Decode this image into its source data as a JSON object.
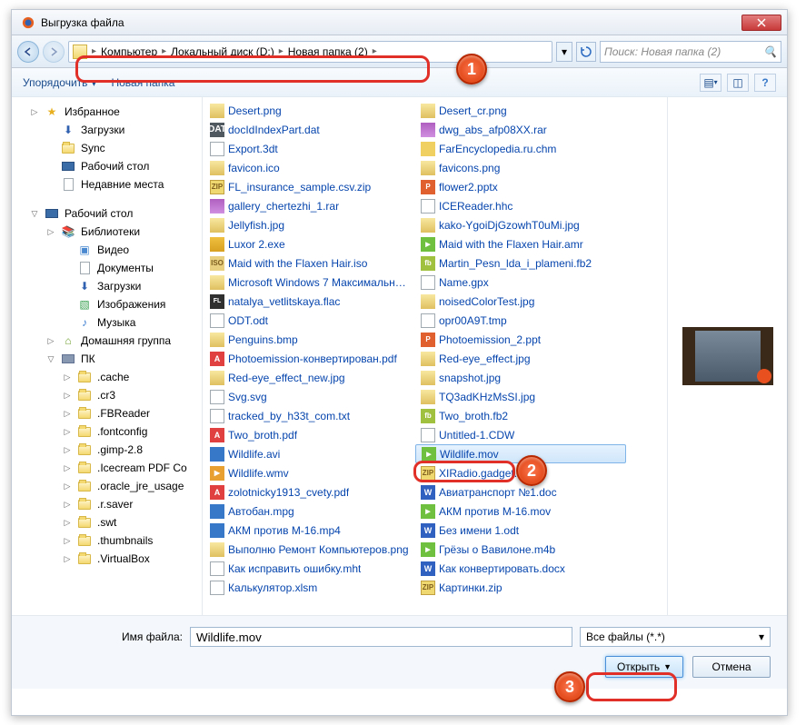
{
  "window": {
    "title": "Выгрузка файла"
  },
  "breadcrumb": [
    {
      "label": "Компьютер"
    },
    {
      "label": "Локальный диск (D:)"
    },
    {
      "label": "Новая папка (2)"
    }
  ],
  "search": {
    "placeholder": "Поиск: Новая папка (2)"
  },
  "toolbar": {
    "organize": "Упорядочить",
    "newfolder": "Новая папка"
  },
  "sidebar": [
    {
      "label": "Избранное",
      "lvl": 1,
      "icon": "star",
      "tog": "▷"
    },
    {
      "label": "Загрузки",
      "lvl": 2,
      "icon": "down"
    },
    {
      "label": "Sync",
      "lvl": 2,
      "icon": "folder"
    },
    {
      "label": "Рабочий стол",
      "lvl": 2,
      "icon": "desk"
    },
    {
      "label": "Недавние места",
      "lvl": 2,
      "icon": "doc"
    },
    {
      "label": "",
      "lvl": 0,
      "spacer": true
    },
    {
      "label": "Рабочий стол",
      "lvl": 1,
      "icon": "desk",
      "tog": "▽"
    },
    {
      "label": "Библиотеки",
      "lvl": 2,
      "icon": "lib",
      "tog": "▷"
    },
    {
      "label": "Видео",
      "lvl": 3,
      "icon": "vid"
    },
    {
      "label": "Документы",
      "lvl": 3,
      "icon": "doc"
    },
    {
      "label": "Загрузки",
      "lvl": 3,
      "icon": "down"
    },
    {
      "label": "Изображения",
      "lvl": 3,
      "icon": "pic"
    },
    {
      "label": "Музыка",
      "lvl": 3,
      "icon": "music"
    },
    {
      "label": "Домашняя группа",
      "lvl": 2,
      "icon": "home",
      "tog": "▷"
    },
    {
      "label": "ПК",
      "lvl": 2,
      "icon": "comp",
      "tog": "▽"
    },
    {
      "label": ".cache",
      "lvl": 3,
      "icon": "folder",
      "tog": "▷"
    },
    {
      "label": ".cr3",
      "lvl": 3,
      "icon": "folder",
      "tog": "▷"
    },
    {
      "label": ".FBReader",
      "lvl": 3,
      "icon": "folder",
      "tog": "▷"
    },
    {
      "label": ".fontconfig",
      "lvl": 3,
      "icon": "folder",
      "tog": "▷"
    },
    {
      "label": ".gimp-2.8",
      "lvl": 3,
      "icon": "folder",
      "tog": "▷"
    },
    {
      "label": ".Icecream PDF Co",
      "lvl": 3,
      "icon": "folder",
      "tog": "▷"
    },
    {
      "label": ".oracle_jre_usage",
      "lvl": 3,
      "icon": "folder",
      "tog": "▷"
    },
    {
      "label": ".r.saver",
      "lvl": 3,
      "icon": "folder",
      "tog": "▷"
    },
    {
      "label": ".swt",
      "lvl": 3,
      "icon": "folder",
      "tog": "▷"
    },
    {
      "label": ".thumbnails",
      "lvl": 3,
      "icon": "folder",
      "tog": "▷"
    },
    {
      "label": ".VirtualBox",
      "lvl": 3,
      "icon": "folder",
      "tog": "▷"
    }
  ],
  "files": [
    {
      "name": "Desert.png",
      "icon": "img"
    },
    {
      "name": "docIdIndexPart.dat",
      "icon": "dat"
    },
    {
      "name": "Export.3dt",
      "icon": "doc"
    },
    {
      "name": "favicon.ico",
      "icon": "img"
    },
    {
      "name": "FL_insurance_sample.csv.zip",
      "icon": "zip"
    },
    {
      "name": "gallery_chertezhi_1.rar",
      "icon": "rar"
    },
    {
      "name": "Jellyfish.jpg",
      "icon": "img"
    },
    {
      "name": "Luxor 2.exe",
      "icon": "exe"
    },
    {
      "name": "Maid with the Flaxen Hair.iso",
      "icon": "iso"
    },
    {
      "name": "Microsoft Windows 7 Максимальна...",
      "icon": "img"
    },
    {
      "name": "natalya_vetlitskaya.flac",
      "icon": "flac"
    },
    {
      "name": "ODT.odt",
      "icon": "doc"
    },
    {
      "name": "Penguins.bmp",
      "icon": "img"
    },
    {
      "name": "Photoemission-конвертирован.pdf",
      "icon": "pdf"
    },
    {
      "name": "Red-eye_effect_new.jpg",
      "icon": "img"
    },
    {
      "name": "Svg.svg",
      "icon": "doc"
    },
    {
      "name": "tracked_by_h33t_com.txt",
      "icon": "txt"
    },
    {
      "name": "Two_broth.pdf",
      "icon": "pdf"
    },
    {
      "name": "Wildlife.avi",
      "icon": "vid"
    },
    {
      "name": "Wildlife.wmv",
      "icon": "wmv"
    },
    {
      "name": "zolotnicky1913_cvety.pdf",
      "icon": "pdf"
    },
    {
      "name": "Автобан.mpg",
      "icon": "vid"
    },
    {
      "name": "АКМ против М-16.mp4",
      "icon": "vid"
    },
    {
      "name": "Выполню Ремонт Компьютеров.png",
      "icon": "img"
    },
    {
      "name": "Как исправить ошибку.mht",
      "icon": "doc"
    },
    {
      "name": "Калькулятор.xlsm",
      "icon": "doc"
    },
    {
      "name": "Desert_cr.png",
      "icon": "img"
    },
    {
      "name": "dwg_abs_afp08XX.rar",
      "icon": "rar"
    },
    {
      "name": "FarEncyclopedia.ru.chm",
      "icon": "chm"
    },
    {
      "name": "favicons.png",
      "icon": "img"
    },
    {
      "name": "flower2.pptx",
      "icon": "ppt"
    },
    {
      "name": "ICEReader.hhc",
      "icon": "doc"
    },
    {
      "name": "kako-YgoiDjGzowhT0uMi.jpg",
      "icon": "img"
    },
    {
      "name": "Maid with the Flaxen Hair.amr",
      "icon": "mov"
    },
    {
      "name": "Martin_Pesn_lda_i_plameni.fb2",
      "icon": "fb2"
    },
    {
      "name": "Name.gpx",
      "icon": "doc"
    },
    {
      "name": "noisedColorTest.jpg",
      "icon": "img"
    },
    {
      "name": "opr00A9T.tmp",
      "icon": "doc"
    },
    {
      "name": "Photoemission_2.ppt",
      "icon": "ppt"
    },
    {
      "name": "Red-eye_effect.jpg",
      "icon": "img"
    },
    {
      "name": "snapshot.jpg",
      "icon": "img"
    },
    {
      "name": "TQ3adKHzMsSI.jpg",
      "icon": "img"
    },
    {
      "name": "Two_broth.fb2",
      "icon": "fb2"
    },
    {
      "name": "Untitled-1.CDW",
      "icon": "doc"
    },
    {
      "name": "Wildlife.mov",
      "icon": "mov",
      "selected": true
    },
    {
      "name": "XIRadio.gadget.zip",
      "icon": "zip"
    },
    {
      "name": "Авиатранспорт №1.doc",
      "icon": "word"
    },
    {
      "name": "АКМ против М-16.mov",
      "icon": "mov"
    },
    {
      "name": "Без имени 1.odt",
      "icon": "word"
    },
    {
      "name": "Грёзы о Вавилоне.m4b",
      "icon": "mov"
    },
    {
      "name": "Как конвертировать.docx",
      "icon": "word"
    },
    {
      "name": "Картинки.zip",
      "icon": "zip"
    }
  ],
  "bottom": {
    "filename_label": "Имя файла:",
    "filename_value": "Wildlife.mov",
    "filetype": "Все файлы (*.*)",
    "open": "Открыть",
    "cancel": "Отмена"
  },
  "badges": {
    "b1": "1",
    "b2": "2",
    "b3": "3"
  }
}
